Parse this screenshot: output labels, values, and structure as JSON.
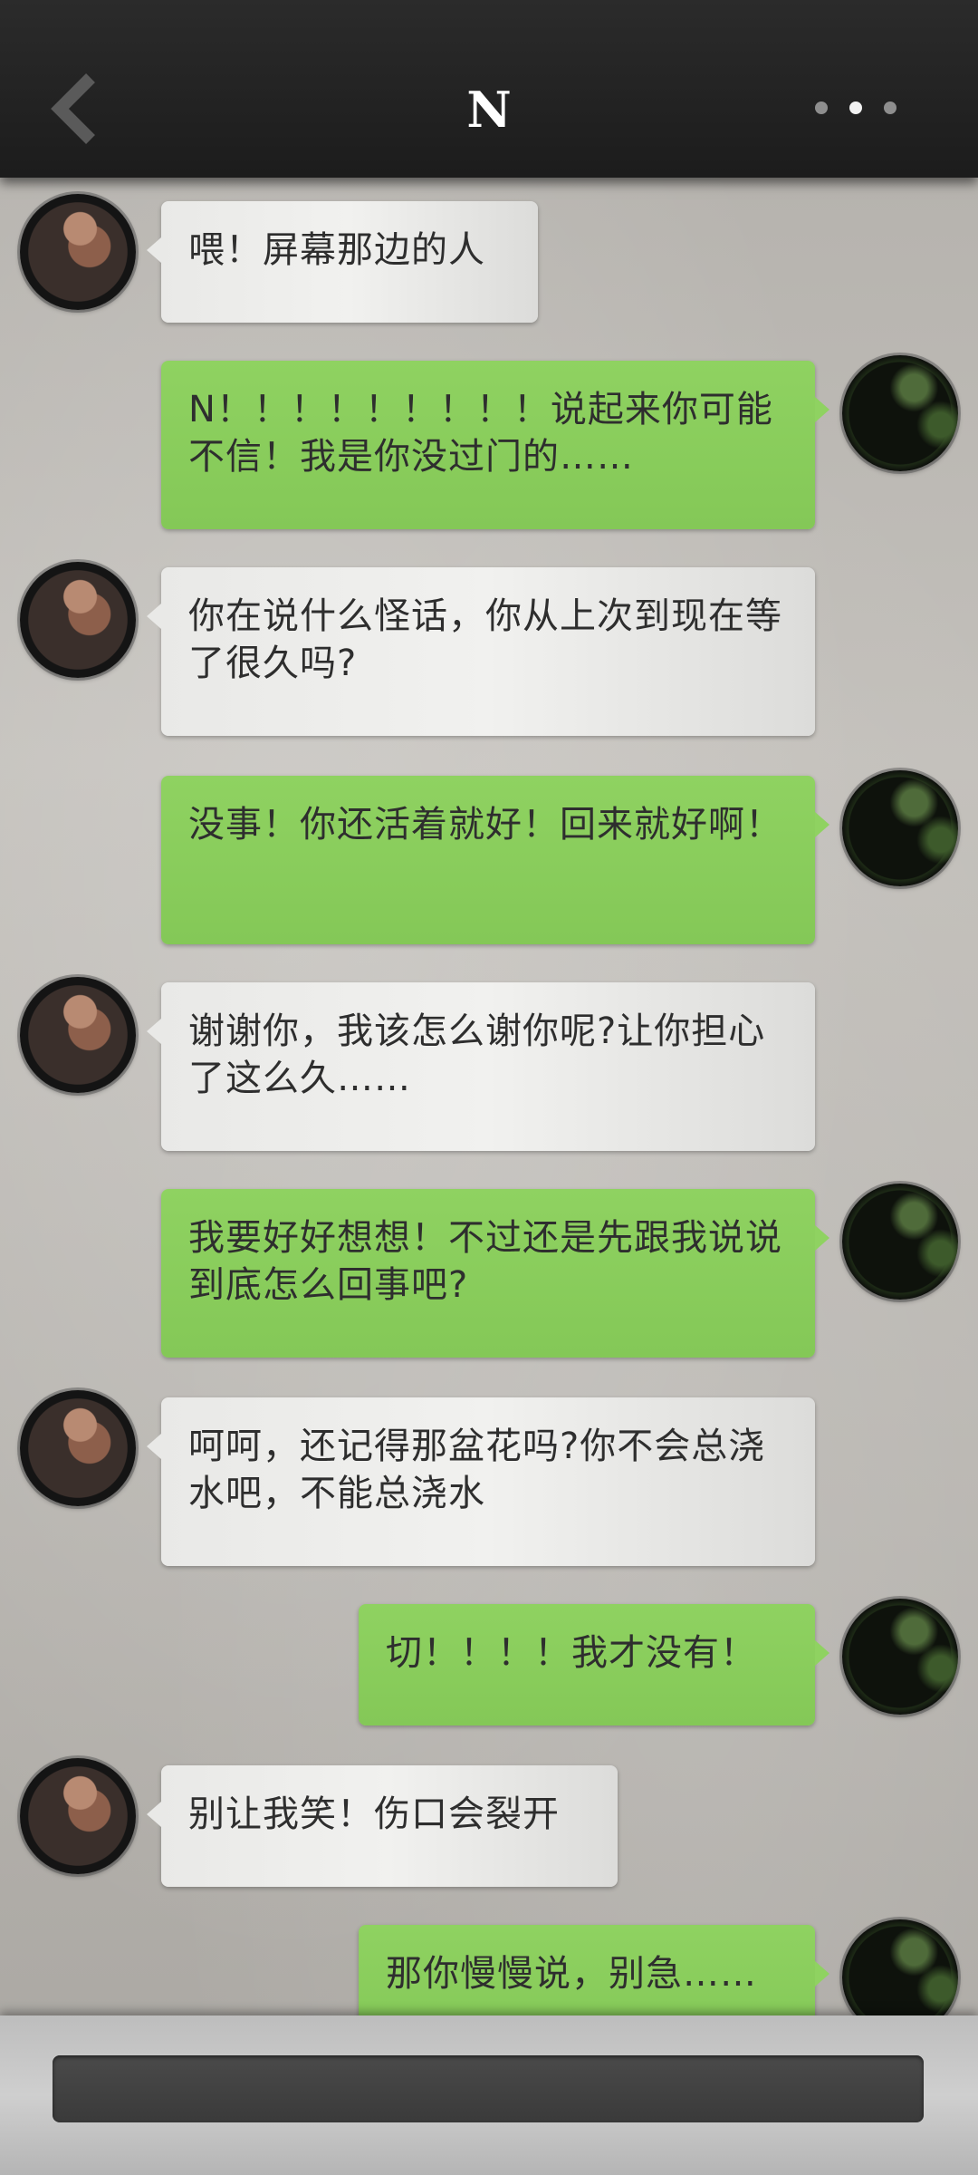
{
  "header": {
    "title": "N",
    "back_icon": "chevron-left-icon",
    "more_icon": "more-dots-icon"
  },
  "messages": [
    {
      "side": "in",
      "text": "喂！屏幕那边的人"
    },
    {
      "side": "out",
      "text": "N！！！！！！！！！说起来你可能不信！我是你没过门的……"
    },
    {
      "side": "in",
      "text": "你在说什么怪话，你从上次到现在等了很久吗?"
    },
    {
      "side": "out",
      "text": "没事！你还活着就好！回来就好啊！"
    },
    {
      "side": "in",
      "text": "谢谢你，我该怎么谢你呢?让你担心了这么久……"
    },
    {
      "side": "out",
      "text": "我要好好想想！不过还是先跟我说说到底怎么回事吧?"
    },
    {
      "side": "in",
      "text": "呵呵，还记得那盆花吗?你不会总浇水吧，不能总浇水"
    },
    {
      "side": "out",
      "text": "切！！！！我才没有！"
    },
    {
      "side": "in",
      "text": "别让我笑！伤口会裂开"
    },
    {
      "side": "out",
      "text": "那你慢慢说，别急……"
    }
  ],
  "colors": {
    "header_bg": "#1f1f1f",
    "incoming_bubble": "#ececea",
    "outgoing_bubble": "#8ace5c",
    "input_bar": "#414141"
  }
}
